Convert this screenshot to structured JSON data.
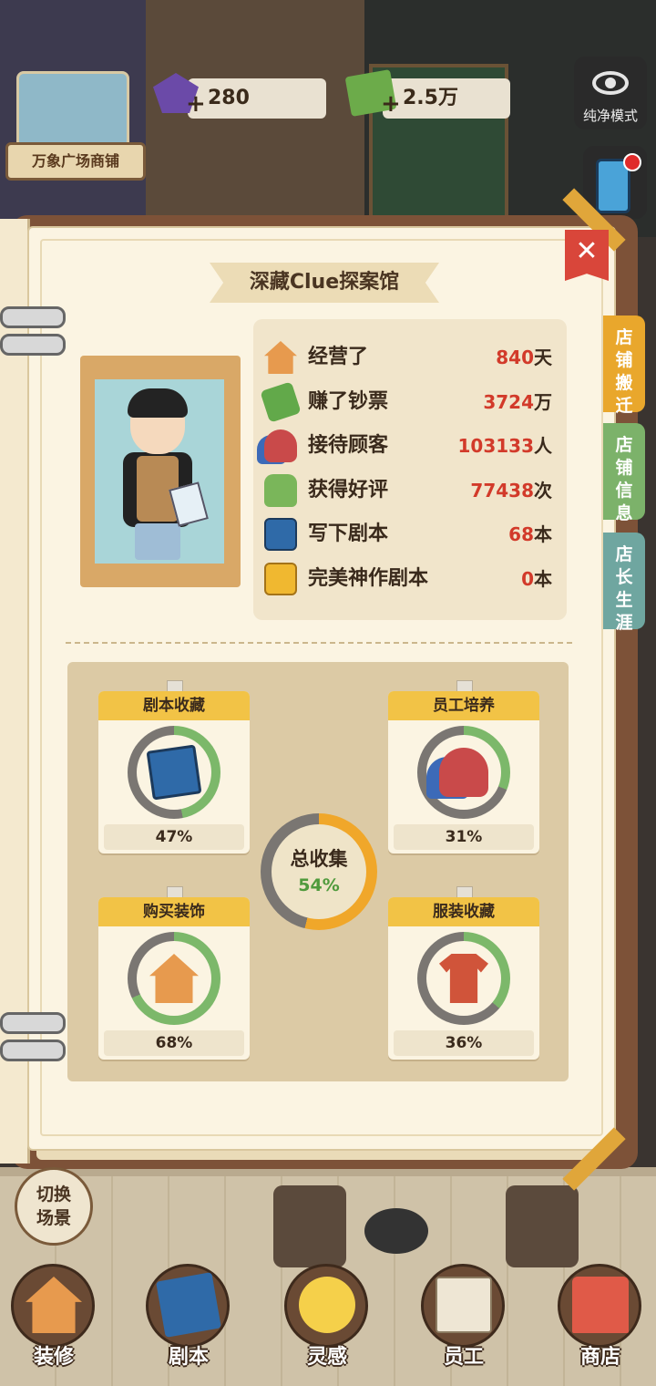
{
  "hud": {
    "shop_name": "万象广场商铺",
    "gems": "280",
    "cash": "2.5万",
    "plus": "+",
    "pure_mode_label": "纯净模式"
  },
  "panel": {
    "title": "深藏Clue探案馆",
    "close": "✕",
    "side_tabs": [
      "店铺搬迁",
      "店铺信息",
      "店长生涯"
    ]
  },
  "stats": [
    {
      "label": "经营了",
      "value": "840",
      "unit": "天",
      "icon": "house-icon"
    },
    {
      "label": "赚了钞票",
      "value": "3724",
      "unit": "万",
      "icon": "money-icon"
    },
    {
      "label": "接待顾客",
      "value": "103133",
      "unit": "人",
      "icon": "people-icon"
    },
    {
      "label": "获得好评",
      "value": "77438",
      "unit": "次",
      "icon": "thumbs-up-icon"
    },
    {
      "label": "写下剧本",
      "value": "68",
      "unit": "本",
      "icon": "script-book-icon"
    },
    {
      "label": "完美神作剧本",
      "value": "0",
      "unit": "本",
      "icon": "gold-script-icon"
    }
  ],
  "collection": {
    "cards": [
      {
        "title": "剧本收藏",
        "percent": "47%",
        "progress": 0.47,
        "icon": "script-book-icon"
      },
      {
        "title": "员工培养",
        "percent": "31%",
        "progress": 0.31,
        "icon": "staff-icon"
      },
      {
        "title": "购买装饰",
        "percent": "68%",
        "progress": 0.68,
        "icon": "house-icon"
      },
      {
        "title": "服装收藏",
        "percent": "36%",
        "progress": 0.36,
        "icon": "shirt-icon"
      }
    ],
    "total_label": "总收集",
    "total_percent": "54%",
    "total_progress": 0.54,
    "ring_color": "#7cb86a",
    "total_ring_color": "#f0a72a"
  },
  "bottom": {
    "switch_scene": "切换\n场景",
    "nav": [
      "装修",
      "剧本",
      "灵感",
      "员工",
      "商店"
    ]
  }
}
